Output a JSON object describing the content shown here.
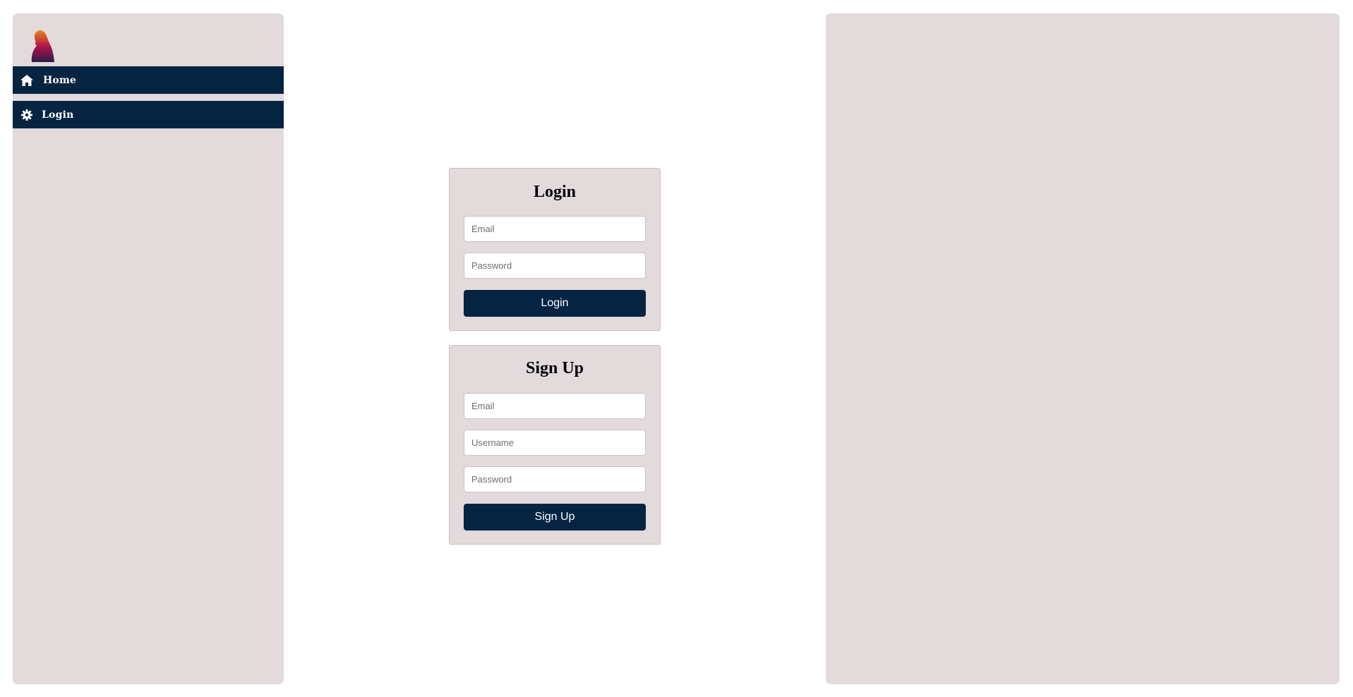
{
  "sidebar": {
    "logo_icon": "hooded-figure-logo",
    "items": [
      {
        "label": "Home",
        "icon": "home-icon"
      },
      {
        "label": "Login",
        "icon": "gear-icon"
      }
    ]
  },
  "login_form": {
    "title": "Login",
    "email_placeholder": "Email",
    "password_placeholder": "Password",
    "submit_label": "Login"
  },
  "signup_form": {
    "title": "Sign Up",
    "email_placeholder": "Email",
    "username_placeholder": "Username",
    "password_placeholder": "Password",
    "submit_label": "Sign Up"
  },
  "colors": {
    "panel_background": "#e3dadb",
    "nav_background": "#042442",
    "button_background": "#042442",
    "logo_gradient": [
      "#e8891a",
      "#b3124a",
      "#2a1e4a"
    ]
  }
}
